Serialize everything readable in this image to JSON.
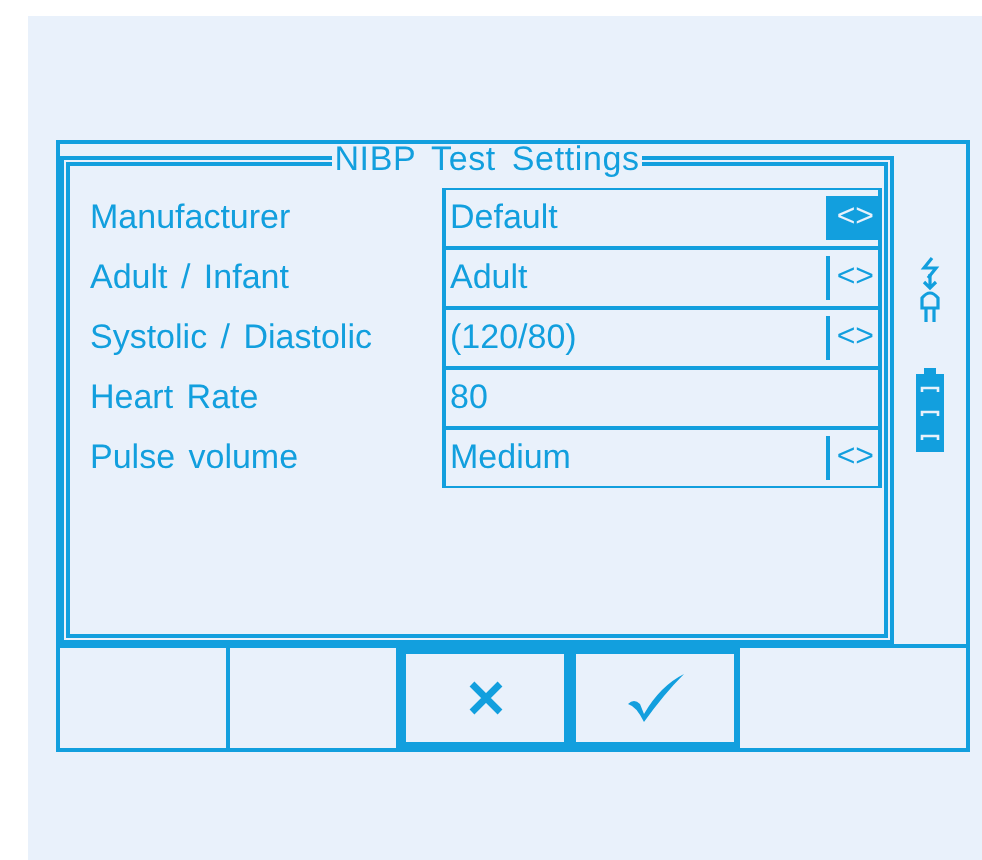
{
  "dialog": {
    "title": "NIBP Test Settings"
  },
  "settings": [
    {
      "label": "Manufacturer",
      "value": "Default",
      "kind": "select",
      "arrows": "<>",
      "selected": true
    },
    {
      "label": "Adult / Infant",
      "value": "Adult",
      "kind": "select",
      "arrows": "<>",
      "selected": false
    },
    {
      "label": "Systolic / Diastolic",
      "value": "(120/80)",
      "kind": "select",
      "arrows": "<>",
      "selected": false
    },
    {
      "label": "Heart Rate",
      "value": "80",
      "kind": "text",
      "selected": false
    },
    {
      "label": "Pulse volume",
      "value": "Medium",
      "kind": "select",
      "arrows": "<>",
      "selected": false
    }
  ],
  "softkeys": [
    {
      "kind": "blank"
    },
    {
      "kind": "blank"
    },
    {
      "kind": "cancel"
    },
    {
      "kind": "confirm"
    },
    {
      "kind": "blank"
    }
  ]
}
